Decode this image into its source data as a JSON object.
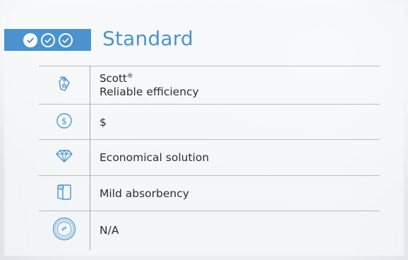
{
  "tier": {
    "title": "Standard",
    "rating_filled": 1,
    "rating_total": 3
  },
  "colors": {
    "accent": "#4a93cf",
    "text": "#2b2f33",
    "divider": "#b9bdc1"
  },
  "rows": [
    {
      "icon": "price-tag-icon",
      "brand": "Scott",
      "brand_mark": "®",
      "text": "Reliable efficiency"
    },
    {
      "icon": "dollar-coin-icon",
      "text": "$"
    },
    {
      "icon": "diamond-icon",
      "text": "Economical solution"
    },
    {
      "icon": "paper-roll-icon",
      "text": "Mild absorbency"
    },
    {
      "icon": "certification-seal-icon",
      "text": "N/A"
    }
  ]
}
